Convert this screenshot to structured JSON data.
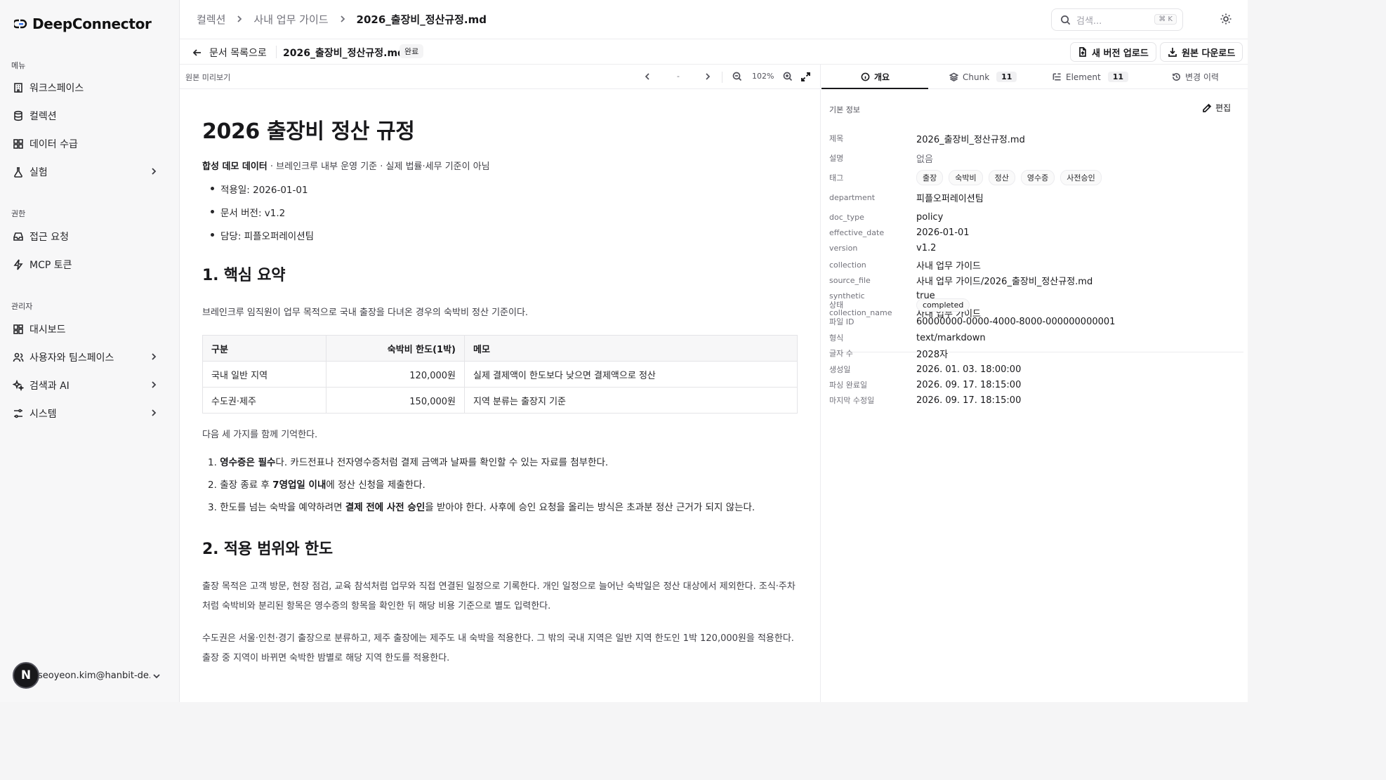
{
  "app": {
    "name": "DeepConnector"
  },
  "sidebar": {
    "sections": [
      {
        "label": "메뉴",
        "items": [
          {
            "label": "워크스페이스",
            "icon": "building-icon",
            "chevron": false
          },
          {
            "label": "컬렉션",
            "icon": "database-icon",
            "chevron": false
          },
          {
            "label": "데이터 수급",
            "icon": "grid-icon",
            "chevron": false
          },
          {
            "label": "실험",
            "icon": "flask-icon",
            "chevron": true
          }
        ]
      },
      {
        "label": "권한",
        "items": [
          {
            "label": "접근 요청",
            "icon": "inbox-icon",
            "chevron": false
          },
          {
            "label": "MCP 토큰",
            "icon": "zap-icon",
            "chevron": false
          }
        ]
      },
      {
        "label": "관리자",
        "items": [
          {
            "label": "대시보드",
            "icon": "dashboard-icon",
            "chevron": false
          },
          {
            "label": "사용자와 팀스페이스",
            "icon": "users-icon",
            "chevron": true
          },
          {
            "label": "검색과 AI",
            "icon": "sparkles-icon",
            "chevron": true
          },
          {
            "label": "시스템",
            "icon": "settings-icon",
            "chevron": true
          }
        ]
      }
    ],
    "user": {
      "initial": "N",
      "email": "seoyeon.kim@hanbit-de..."
    }
  },
  "header": {
    "breadcrumbs": [
      "컬렉션",
      "사내 업무 가이드",
      "2026_출장비_정산규정.md"
    ],
    "search": {
      "placeholder": "검색...",
      "shortcut": "⌘ K"
    }
  },
  "doc_toolbar": {
    "back_label": "문서 목록으로",
    "doc_name": "2026_출장비_정산규정.md",
    "status": "완료",
    "upload_label": "새 버전 업로드",
    "download_label": "원본 다운로드"
  },
  "preview": {
    "title": "원본 미리보기",
    "page": "-",
    "zoom": "102%"
  },
  "document": {
    "h1": "2026 출장비 정산 규정",
    "lead_bold": "합성 데모 데이터",
    "lead_rest": " · 브레인크루 내부 운영 기준 · 실제 법률·세무 기준이 아님",
    "bullets": [
      "적용일: 2026-01-01",
      "문서 버전: v1.2",
      "담당: 피플오퍼레이션팀"
    ],
    "h2_1": "1. 핵심 요약",
    "p1": "브레인크루 임직원이 업무 목적으로 국내 출장을 다녀온 경우의 숙박비 정산 기준이다.",
    "table": {
      "headers": [
        "구분",
        "숙박비 한도(1박)",
        "메모"
      ],
      "rows": [
        [
          "국내 일반 지역",
          "120,000원",
          "실제 결제액이 한도보다 낮으면 결제액으로 정산"
        ],
        [
          "수도권·제주",
          "150,000원",
          "지역 분류는 출장지 기준"
        ]
      ]
    },
    "p2": "다음 세 가지를 함께 기억한다.",
    "ordered": [
      {
        "num": "1.",
        "bold": "영수증은 필수",
        "pre": "",
        "post": "다. 카드전표나 전자영수증처럼 결제 금액과 날짜를 확인할 수 있는 자료를 첨부한다."
      },
      {
        "num": "2.",
        "pre": "출장 종료 후 ",
        "bold": "7영업일 이내",
        "post": "에 정산 신청을 제출한다."
      },
      {
        "num": "3.",
        "pre": "한도를 넘는 숙박을 예약하려면 ",
        "bold": "결제 전에 사전 승인",
        "post": "을 받아야 한다. 사후에 승인 요청을 올리는 방식은 초과분 정산 근거가 되지 않는다."
      }
    ],
    "h2_2": "2. 적용 범위와 한도",
    "p3": "출장 목적은 고객 방문, 현장 점검, 교육 참석처럼 업무와 직접 연결된 일정으로 기록한다. 개인 일정으로 늘어난 숙박일은 정산 대상에서 제외한다. 조식·주차처럼 숙박비와 분리된 항목은 영수증의 항목을 확인한 뒤 해당 비용 기준으로 별도 입력한다.",
    "p4": "수도권은 서울·인천·경기 출장으로 분류하고, 제주 출장에는 제주도 내 숙박을 적용한다. 그 밖의 국내 지역은 일반 지역 한도인 1박 120,000원을 적용한다. 출장 중 지역이 바뀌면 숙박한 밤별로 해당 지역 한도를 적용한다."
  },
  "panel": {
    "tabs": [
      {
        "label": "개요",
        "icon": "info-icon",
        "count": ""
      },
      {
        "label": "Chunk",
        "icon": "layers-icon",
        "count": "11"
      },
      {
        "label": "Element",
        "icon": "list-tree-icon",
        "count": "11"
      },
      {
        "label": "변경 이력",
        "icon": "history-icon",
        "count": ""
      }
    ],
    "section_title": "기본 정보",
    "edit_label": "편집",
    "fields": [
      {
        "key": "제목",
        "value": "2026_출장비_정산규정.md"
      },
      {
        "key": "설명",
        "value": "없음"
      },
      {
        "key": "태그",
        "tags": [
          "출장",
          "숙박비",
          "정산",
          "영수증",
          "사전승인"
        ]
      },
      {
        "key": "department",
        "value": "피플오퍼레이션팀"
      },
      {
        "key": "doc_type",
        "value": "policy"
      },
      {
        "key": "effective_date",
        "value": "2026-01-01"
      },
      {
        "key": "version",
        "value": "v1.2"
      },
      {
        "key": "collection",
        "value": "사내 업무 가이드"
      },
      {
        "key": "source_file",
        "value": "사내 업무 가이드/2026_출장비_정산규정.md"
      },
      {
        "key": "synthetic",
        "value": "true"
      },
      {
        "key": "collection_name",
        "value": "사내 업무 가이드"
      }
    ],
    "meta": [
      {
        "key": "상태",
        "chip": "completed"
      },
      {
        "key": "파일 ID",
        "value": "60000000-0000-4000-8000-000000000001"
      },
      {
        "key": "형식",
        "value": "text/markdown"
      },
      {
        "key": "글자 수",
        "value": "2028자"
      },
      {
        "key": "생성일",
        "value": "2026. 01. 03. 18:00:00"
      },
      {
        "key": "파싱 완료일",
        "value": "2026. 09. 17. 18:15:00"
      },
      {
        "key": "마지막 수정일",
        "value": "2026. 09. 17. 18:15:00"
      }
    ]
  }
}
